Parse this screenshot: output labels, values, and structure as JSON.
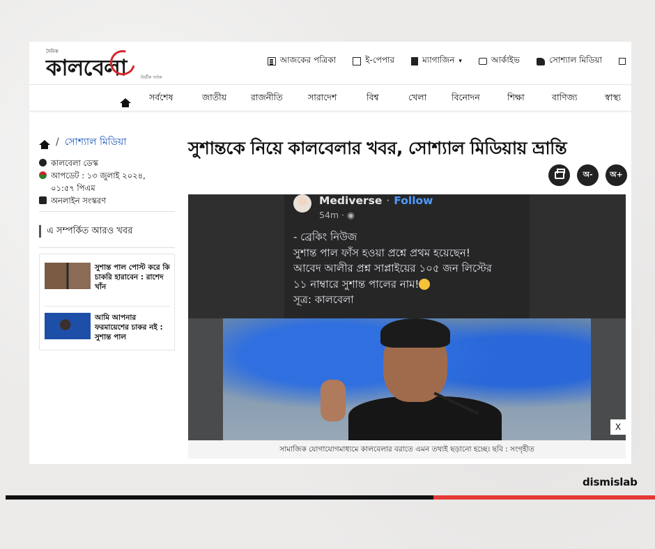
{
  "header": {
    "logo_small": "দৈনিক",
    "logo_text": "কালবেলা",
    "logo_tagline": "নির্ভীক পাঠক",
    "top_nav": [
      {
        "icon": "newspaper-icon",
        "label": "আজকের পত্রিকা"
      },
      {
        "icon": "epaper-icon",
        "label": "ই-পেপার"
      },
      {
        "icon": "magazine-icon",
        "label": "ম্যাগাজিন"
      },
      {
        "icon": "archive-icon",
        "label": "আর্কাইভ"
      },
      {
        "icon": "thumbs-up-icon",
        "label": "সোশ্যাল মিডিয়া"
      }
    ],
    "categories": [
      "সর্বশেষ",
      "জাতীয়",
      "রাজনীতি",
      "সারাদেশ",
      "বিশ্ব",
      "খেলা",
      "বিনোদন",
      "শিক্ষা",
      "বাণিজ্য",
      "স্বাস্থ্য"
    ]
  },
  "breadcrumb": {
    "separator": "/",
    "section": "সোশ্যাল মিডিয়া"
  },
  "meta": {
    "author": "কালবেলা ডেস্ক",
    "updated_line1": "আপডেট : ১৩ জুলাই ২০২৪,",
    "updated_line2": "০১:৫৭ পিএম",
    "edition": "অনলাইন সংস্করণ"
  },
  "related": {
    "title": "এ সম্পর্কিত আরও খবর",
    "items": [
      {
        "title": "সুশান্ত পাল পোস্ট করে কি চাকরি হারাবেন : রাশেদ খাঁন"
      },
      {
        "title": "আমি আপনার ফরমায়েশের চাকর নই : সুশান্ত পাল"
      }
    ]
  },
  "article": {
    "headline": "সুশান্তকে নিয়ে কালবেলার খবর, সোশ্যাল মিডিয়ায় ভ্রান্তি",
    "tools": {
      "font_decrease": "অ-",
      "font_increase": "অ+"
    },
    "caption": "সামাজিক যোগাযোগমাধ্যমে কালবেলার বরাতে এমন তথ্যই ছড়ানো হচ্ছে। ছবি : সংগৃহীত",
    "close_label": "X"
  },
  "facebook_post": {
    "page_name": "Mediverse",
    "separator": "·",
    "follow": "Follow",
    "time": "54m · ",
    "lines": [
      "- ব্রেকিং নিউজ",
      "সুশান্ত পাল ফাঁস হওয়া প্রশ্নে প্রথম হয়েছেন!",
      "আবেদ আলীর প্রশ্ন সাপ্লাইয়ের ১০৫ জন লিস্টের",
      "১১ নাম্বারে সুশান্ত পালের নাম!",
      "সূত্র: কালবেলা"
    ]
  },
  "footer": {
    "brand": "dismislab"
  },
  "colors": {
    "link": "#1a56b8",
    "accent_red": "#e53935",
    "fb_follow": "#4d9bff"
  }
}
